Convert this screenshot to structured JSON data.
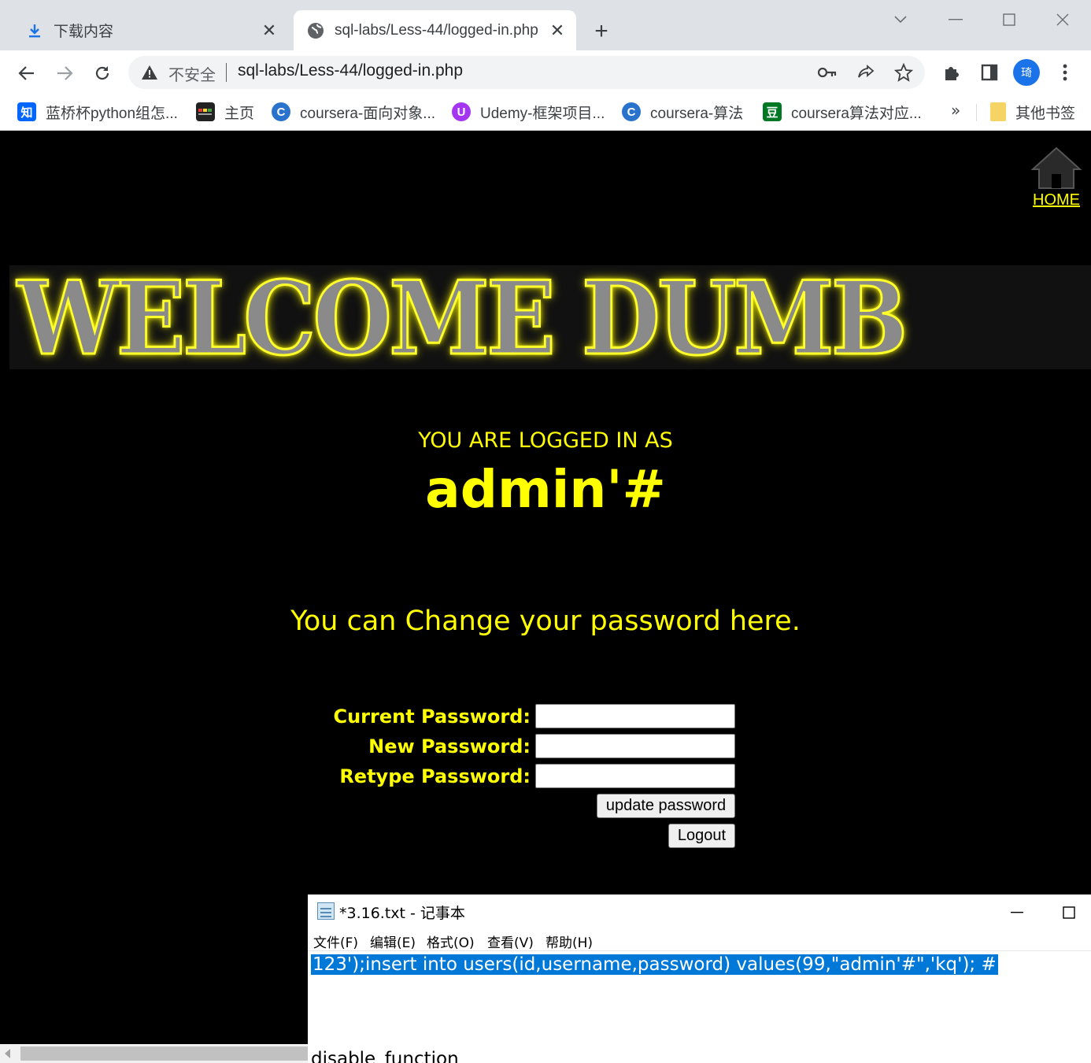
{
  "browser": {
    "tabs": [
      {
        "title": "下载内容",
        "icon": "download-icon",
        "active": false
      },
      {
        "title": "sql-labs/Less-44/logged-in.php",
        "icon": "globe-icon",
        "active": true
      }
    ],
    "address": {
      "security": "不安全",
      "url": "sql-labs/Less-44/logged-in.php"
    },
    "avatar_label": "琦",
    "bookmarks": [
      {
        "label": "蓝桥杯python组怎...",
        "icon": "zhihu-icon",
        "color": "#0066ff",
        "glyph": "知"
      },
      {
        "label": "主页",
        "icon": "homepage-icon",
        "color": "#222222",
        "glyph": ""
      },
      {
        "label": "coursera-面向对象...",
        "icon": "coursera-icon",
        "color": "#2a73cc",
        "glyph": "C"
      },
      {
        "label": "Udemy-框架项目...",
        "icon": "udemy-icon",
        "color": "#a435f0",
        "glyph": "U"
      },
      {
        "label": "coursera-算法",
        "icon": "coursera-icon",
        "color": "#2a73cc",
        "glyph": "C"
      },
      {
        "label": "coursera算法对应...",
        "icon": "douban-icon",
        "color": "#007722",
        "glyph": "豆"
      }
    ],
    "bookmarks_more": "»",
    "other_bookmarks": "其他书签"
  },
  "page": {
    "home_label": "HOME",
    "banner_text": "WELCOME DUMB",
    "logged_label": "YOU ARE LOGGED IN AS",
    "username": "admin'#",
    "change_msg": "You can Change your password here.",
    "form": {
      "current_label": "Current Password:",
      "new_label": "New Password:",
      "retype_label": "Retype Password:",
      "current_value": "",
      "new_value": "",
      "retype_value": "",
      "update_button": "update password",
      "logout_button": "Logout"
    },
    "colors": {
      "accent": "#ffff00",
      "background": "#000000"
    }
  },
  "notepad": {
    "title": "*3.16.txt - 记事本",
    "menus": [
      "文件(F)",
      "编辑(E)",
      "格式(O)",
      "查看(V)",
      "帮助(H)"
    ],
    "line1": "123');insert into users(id,username,password) values(99,\"admin'#\",'kq'); #",
    "line2": "disable_function",
    "selection_color": "#0078d7"
  }
}
